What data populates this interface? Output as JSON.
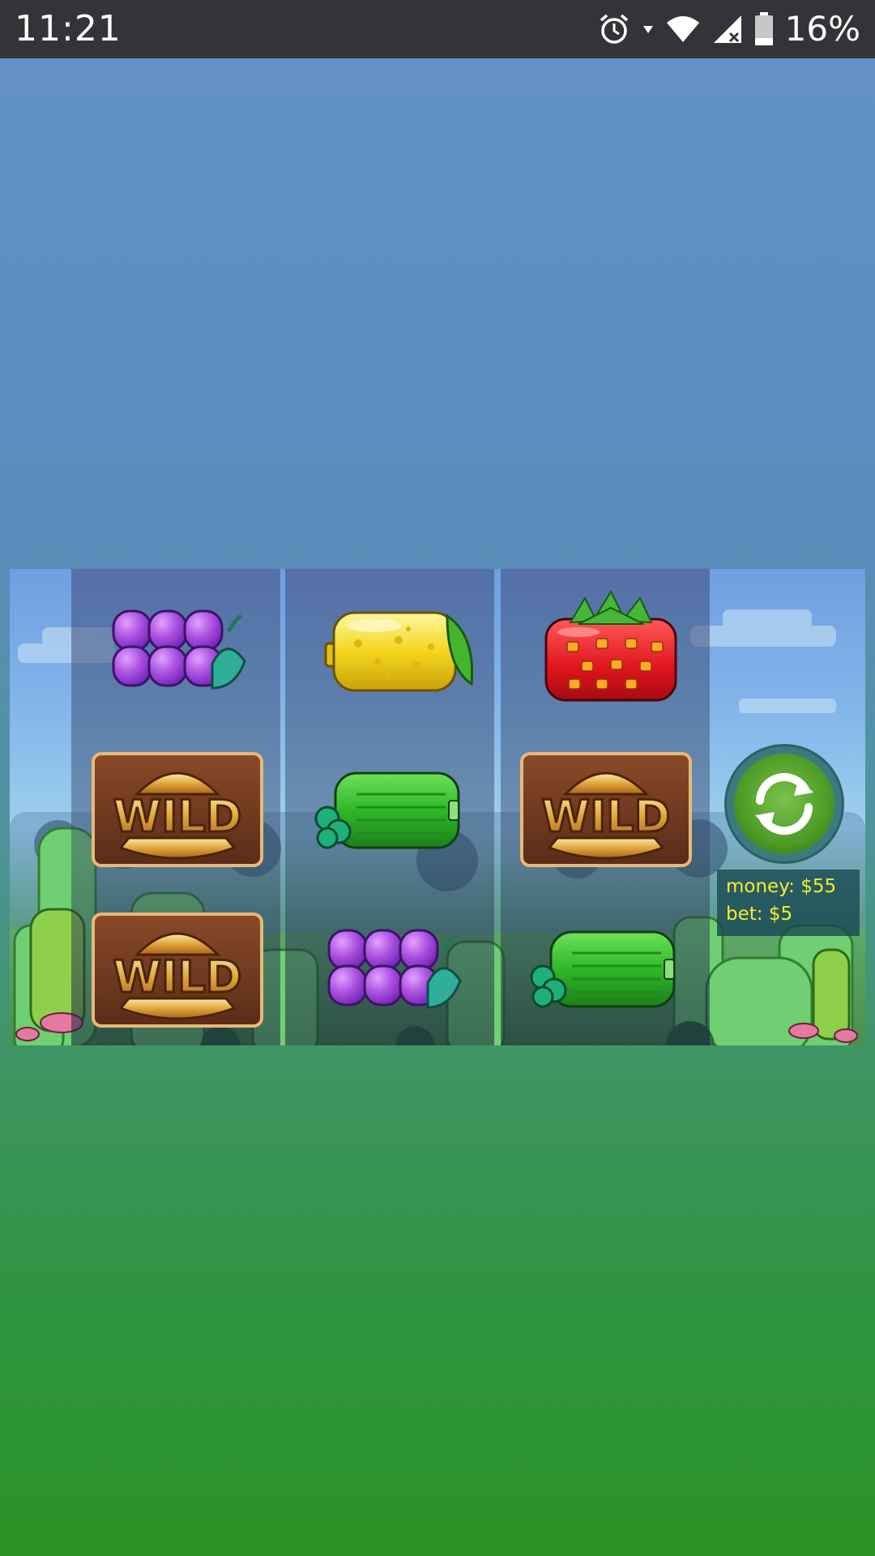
{
  "status_bar": {
    "time": "11:21",
    "battery_percent": "16%",
    "icons": [
      "alarm-icon",
      "wifi-icon",
      "signal-icon",
      "battery-icon"
    ]
  },
  "game": {
    "reels": [
      [
        "grape",
        "wild",
        "wild"
      ],
      [
        "lemon",
        "cucumber",
        "grape"
      ],
      [
        "strawberry",
        "wild",
        "cucumber"
      ]
    ],
    "wild_label": "WILD",
    "spin_icon": "refresh-icon",
    "info": {
      "money": "money: $55",
      "bet": "bet: $5"
    }
  }
}
